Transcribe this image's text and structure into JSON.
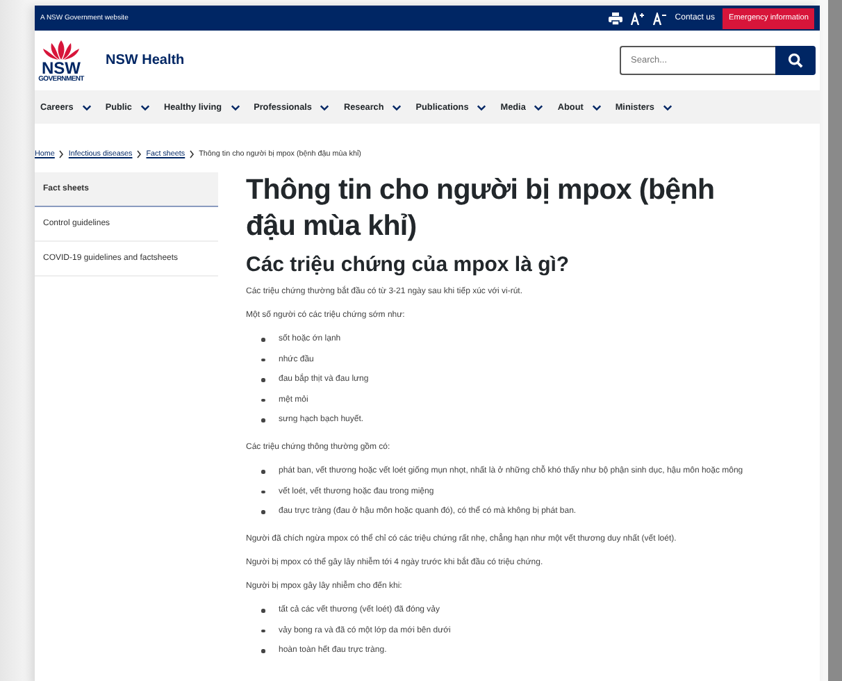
{
  "top_bar": {
    "label": "A NSW Government website",
    "contact": "Contact us",
    "emergency": "Emergency information"
  },
  "header": {
    "logo_text": "NSW",
    "logo_sub": "GOVERNMENT",
    "site_name": "NSW Health",
    "search": {
      "placeholder": "Search..."
    }
  },
  "nav": [
    "Careers",
    "Public",
    "Healthy living",
    "Professionals",
    "Research",
    "Publications",
    "Media",
    "About",
    "Ministers"
  ],
  "breadcrumb": {
    "links": [
      "Home",
      "Infectious diseases",
      "Fact sheets"
    ],
    "current": "Thông tin cho người bị mpox (bệnh đậu mùa khỉ)"
  },
  "sidebar": {
    "items": [
      {
        "label": "Fact sheets",
        "selected": true
      },
      {
        "label": "Control guidelines",
        "selected": false
      },
      {
        "label": "COVID-19 guidelines and factsheets",
        "selected": false
      }
    ]
  },
  "article": {
    "title": "Thông tin cho người bị mpox (bệnh đậu mùa khỉ)",
    "heading": "Các triệu chứng của mpox là gì?",
    "blocks": [
      {
        "kind": "para",
        "text": "Các triệu chứng thường bắt đầu có từ 3-21 ngày sau khi tiếp xúc với vi-rút."
      },
      {
        "kind": "para",
        "text": "Một số người có các triệu chứng sớm như:"
      },
      {
        "kind": "list",
        "items": [
          "sốt hoặc ớn lạnh",
          "nhức đầu",
          "đau bắp thịt và đau lưng",
          "mệt mỏi",
          "sưng hạch bạch huyết."
        ]
      },
      {
        "kind": "para",
        "text": "Các triệu chứng thông thường gồm có:"
      },
      {
        "kind": "list",
        "items": [
          "phát ban, vết thương hoặc vết loét giống mụn nhọt, nhất là ở những chỗ khó thấy như bộ phận sinh dục, hậu môn hoặc mông",
          "vết loét, vết thương hoặc đau trong miệng",
          "đau trực tràng (đau ở hậu môn hoặc quanh đó), có thể có mà không bị phát ban."
        ]
      },
      {
        "kind": "para",
        "text": "Người đã chích ngừa mpox có thể chỉ có các triệu chứng rất nhẹ, chẳng hạn như một vết thương duy nhất (vết loét)."
      },
      {
        "kind": "para",
        "text": "Người bị mpox có thể gây lây nhiễm tới 4 ngày trước khi bắt đầu có triệu chứng."
      },
      {
        "kind": "para",
        "text": "Người bị mpox gây lây nhiễm cho đến khi:"
      },
      {
        "kind": "list",
        "items": [
          "tất cả các vết thương (vết loét) đã đóng vảy",
          "vảy bong ra và đã có một lớp da mới bên dưới",
          "hoàn toàn hết đau trực tràng."
        ]
      }
    ]
  }
}
